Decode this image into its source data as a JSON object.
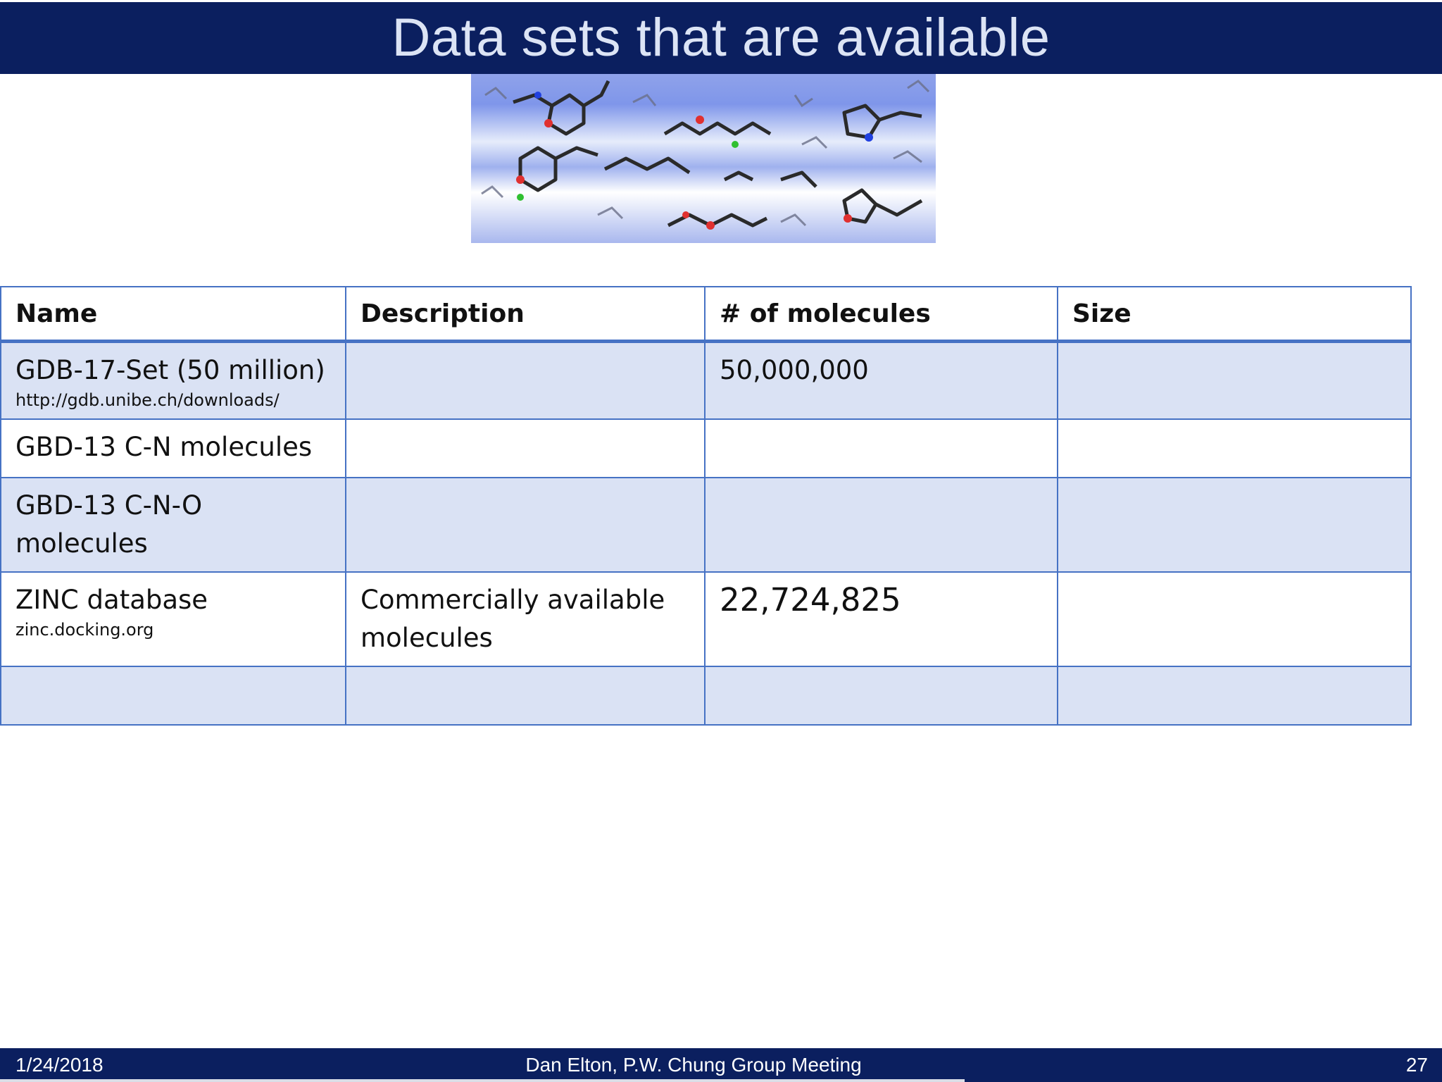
{
  "slide": {
    "title": "Data sets that are available"
  },
  "table": {
    "headers": [
      "Name",
      "Description",
      "# of molecules",
      "Size"
    ],
    "rows": [
      {
        "name": "GDB-17-Set (50 million)",
        "name_sub": "http://gdb.unibe.ch/downloads/",
        "description": "",
        "molecules": "50,000,000",
        "size": ""
      },
      {
        "name": "GBD-13 C-N molecules",
        "name_sub": "",
        "description": "",
        "molecules": "",
        "size": ""
      },
      {
        "name": "GBD-13 C-N-O molecules",
        "name_sub": "",
        "description": "",
        "molecules": "",
        "size": ""
      },
      {
        "name": "ZINC database",
        "name_sub": "zinc.docking.org",
        "description": "Commercially available molecules",
        "molecules": "22,724,825",
        "size": ""
      },
      {
        "name": "",
        "name_sub": "",
        "description": "",
        "molecules": "",
        "size": ""
      }
    ]
  },
  "footer": {
    "date": "1/24/2018",
    "center": "Dan Elton, P.W. Chung Group Meeting",
    "page": "27"
  },
  "colors": {
    "title_bar": "#0b1f5f",
    "table_border": "#4672c4",
    "row_shade": "#dae2f4"
  }
}
